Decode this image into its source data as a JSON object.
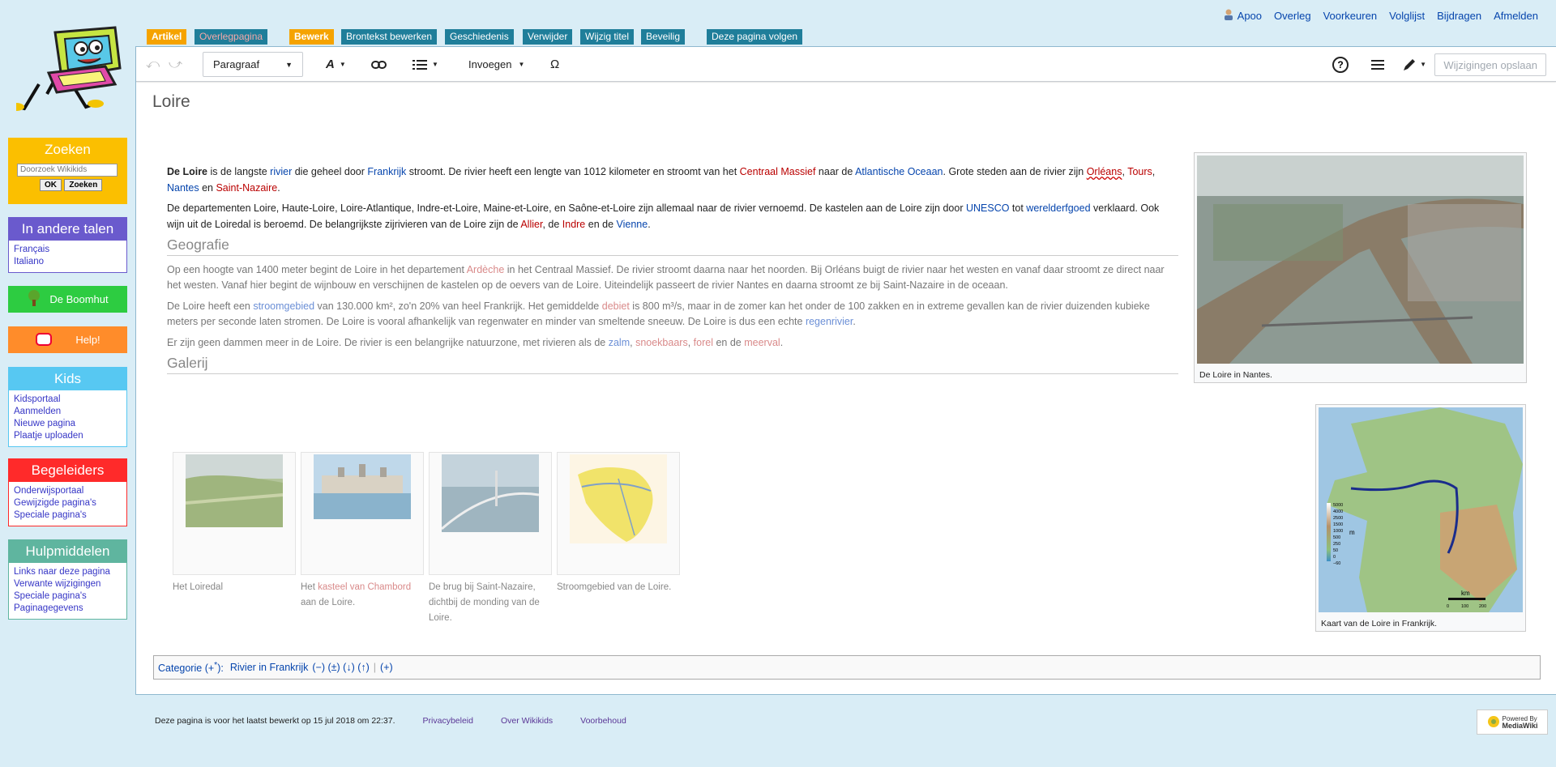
{
  "sidebar": {
    "search": {
      "title": "Zoeken",
      "placeholder": "Doorzoek Wikikids",
      "ok": "OK",
      "search": "Zoeken"
    },
    "languages": {
      "title": "In andere talen",
      "items": [
        "Français",
        "Italiano"
      ]
    },
    "boomhut": "De Boomhut",
    "help": "Help!",
    "kids": {
      "title": "Kids",
      "items": [
        "Kidsportaal",
        "Aanmelden",
        "Nieuwe pagina",
        "Plaatje uploaden"
      ]
    },
    "begeleiders": {
      "title": "Begeleiders",
      "items": [
        "Onderwijsportaal",
        "Gewijzigde pagina's",
        "Speciale pagina's"
      ]
    },
    "hulpmiddelen": {
      "title": "Hulpmiddelen",
      "items": [
        "Links naar deze pagina",
        "Verwante wijzigingen",
        "Speciale pagina's",
        "Paginagegevens"
      ]
    }
  },
  "personal": [
    "Apoo",
    "Overleg",
    "Voorkeuren",
    "Volglijst",
    "Bijdragen",
    "Afmelden"
  ],
  "tabs": [
    "Artikel",
    "Overlegpagina",
    "Bewerk",
    "Brontekst bewerken",
    "Geschiedenis",
    "Verwijder",
    "Wijzig titel",
    "Beveilig",
    "Deze pagina volgen"
  ],
  "toolbar": {
    "paragraph": "Paragraaf",
    "insert": "Invoegen",
    "save": "Wijzigingen opslaan",
    "omega": "Ω"
  },
  "title": "Loire",
  "intro": {
    "p1": [
      "De Loire",
      " is de langste ",
      "rivier",
      " die geheel door ",
      "Frankrijk",
      " stroomt.  De rivier heeft een lengte van 1012 kilometer en stroomt van het ",
      "Centraal Massief",
      " naar de ",
      "Atlantische Oceaan",
      ". Grote steden aan de rivier zijn ",
      "Orléans",
      ", ",
      "Tours",
      ", ",
      "Nantes",
      " en ",
      "Saint-Nazaire",
      "."
    ],
    "p2": [
      "De departementen Loire, Haute-Loire, Loire-Atlantique, Indre-et-Loire, Maine-et-Loire, en Saône-et-Loire zijn allemaal naar de rivier vernoemd. De kastelen aan de Loire zijn door ",
      "UNESCO",
      " tot ",
      "werelderfgoed",
      " verklaard. Ook wijn uit de Loiredal is beroemd. De belangrijkste zijrivieren van de Loire zijn de ",
      "Allier",
      ", de ",
      "Indre",
      " en de ",
      "Vienne",
      "."
    ]
  },
  "geo": {
    "heading": "Geografie",
    "p1": [
      "Op een hoogte van 1400 meter begint de Loire in het departement ",
      "Ardèche",
      " in het Centraal Massief. De rivier stroomt daarna naar het noorden. Bij Orléans buigt de rivier naar het westen en vanaf daar stroomt ze direct naar het westen. Vanaf hier begint de wijnbouw en verschijnen de kastelen op de oevers van de Loire. Uiteindelijk passeert de rivier Nantes en daarna stroomt ze bij Saint-Nazaire in de oceaan."
    ],
    "p2": [
      "De Loire heeft een ",
      "stroomgebied",
      " van 130.000 km², zo'n 20% van heel Frankrijk. Het gemiddelde ",
      "debiet",
      " is 800 m³/s, maar in de zomer kan het onder de 100 zakken en in extreme gevallen kan de rivier duizenden kubieke meters per seconde laten stromen. De Loire is vooral afhankelijk van regenwater en minder van smeltende sneeuw. De Loire is dus een echte ",
      "regenrivier",
      "."
    ],
    "p3": [
      "Er zijn geen dammen meer in de Loire. De rivier is een belangrijke natuurzone, met rivieren als de ",
      "zalm",
      ", ",
      "snoekbaars",
      ", ",
      "forel",
      " en de ",
      "meerval",
      "."
    ]
  },
  "gallery": {
    "heading": "Galerij",
    "cap1": "Het Loiredal",
    "cap2a": "Het ",
    "cap2b": "kasteel van Chambord",
    "cap2c": " aan de Loire.",
    "cap3": "De brug bij Saint-Nazaire, dichtbij de monding van de Loire.",
    "cap4": "Stroomgebied van de Loire."
  },
  "thumbs": {
    "nantes": "De Loire in Nantes.",
    "map": "Kaart van de Loire in Frankrijk.",
    "legend": [
      "5000",
      "4000",
      "2500",
      "1500",
      "1000",
      "500",
      "250",
      "50",
      "0",
      "−60"
    ],
    "legend_unit": "m",
    "scale": "km",
    "scale_ticks": [
      "0",
      "100",
      "200"
    ]
  },
  "category": {
    "label": "Categorie",
    "plus": "(+",
    "sup": "*",
    "close": "):",
    "name": "Rivier in Frankrijk",
    "ops": "(−) (±) (↓) (↑)",
    "sep": "|",
    "add": "(+)"
  },
  "footer": {
    "lastedit": "Deze pagina is voor het laatst bewerkt op 15 jul 2018 om 22:37.",
    "privacy": "Privacybeleid",
    "about": "Over Wikikids",
    "disclaimer": "Voorbehoud"
  },
  "powered": {
    "line1": "Powered By",
    "line2": "MediaWiki"
  },
  "colors": {
    "tab_orange": "#f5a300",
    "tab_teal": "#1f7e9a",
    "link_blue": "#0645ad",
    "link_red": "#ba0000",
    "search": "#fbbf00",
    "languages": "#6a5acd",
    "boomhut": "#2dcc41",
    "help": "#ff8c2a",
    "kids": "#57c8f2",
    "begeleiders": "#ff2a2a",
    "hulpmiddelen": "#5fb59f"
  }
}
